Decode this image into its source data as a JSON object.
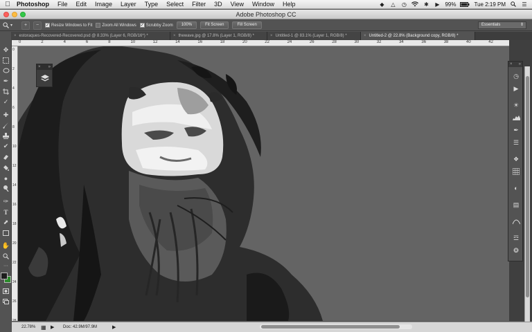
{
  "menubar": {
    "app_name": "Photoshop",
    "items": [
      "File",
      "Edit",
      "Image",
      "Layer",
      "Type",
      "Select",
      "Filter",
      "3D",
      "View",
      "Window",
      "Help"
    ],
    "battery": "99%",
    "clock": "Tue 2:19 PM"
  },
  "window": {
    "title": "Adobe Photoshop CC"
  },
  "options": {
    "resize_windows": "Resize Windows to Fit",
    "zoom_all": "Zoom All Windows",
    "scrubby_zoom": "Scrubby Zoom",
    "btn_100": "100%",
    "btn_fit": "Fit Screen",
    "btn_fill": "Fill Screen",
    "workspace": "Essentials"
  },
  "tabs": [
    {
      "label": "estoraques-Recovered-Recovered.psd @ 8.33% (Layer 6, RGB/16*) *"
    },
    {
      "label": "thewave.jpg @ 17.8% (Layer 1, RGB/8) *"
    },
    {
      "label": "Untitled-1 @ 83.1% (Layer 1, RGB/8) *"
    },
    {
      "label": "Untitled-2 @ 22.8% (Background copy, RGB/8) *"
    }
  ],
  "ruler": {
    "h": [
      "0",
      "2",
      "4",
      "6",
      "8",
      "10",
      "12",
      "14",
      "16",
      "18",
      "20",
      "22",
      "24",
      "26",
      "28",
      "30",
      "32",
      "34",
      "36",
      "38",
      "40",
      "42"
    ],
    "v": [
      "0",
      "2",
      "4",
      "6",
      "8",
      "10",
      "12",
      "14",
      "16",
      "18",
      "20",
      "22",
      "24",
      "26",
      "28"
    ]
  },
  "status": {
    "zoom": "22.78%",
    "doc": "Doc: 42.9M/97.9M"
  },
  "colors": {
    "accent": "#535353",
    "foreground": "#1d1d1d",
    "background": "#2b8a2b"
  }
}
